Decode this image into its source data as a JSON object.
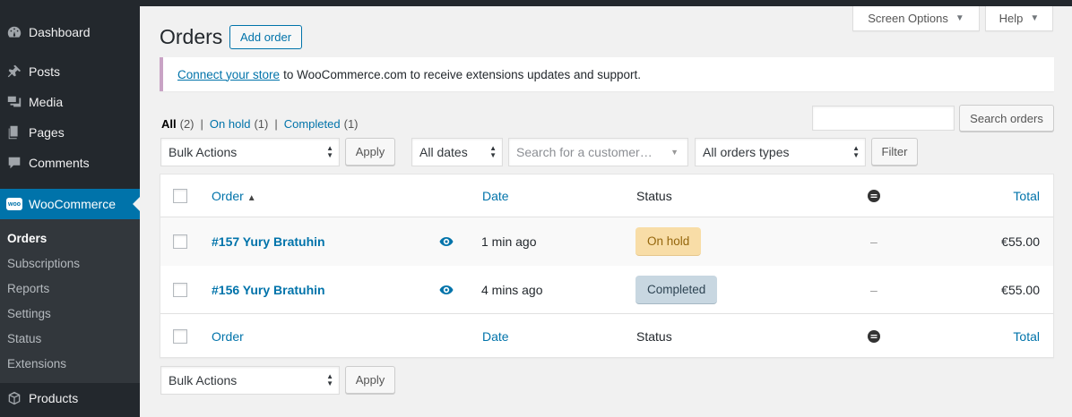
{
  "sidebar": {
    "items": [
      {
        "label": "Dashboard",
        "icon": "dashboard-icon"
      },
      {
        "label": "Posts",
        "icon": "pin-icon"
      },
      {
        "label": "Media",
        "icon": "media-icon"
      },
      {
        "label": "Pages",
        "icon": "pages-icon"
      },
      {
        "label": "Comments",
        "icon": "comment-icon"
      },
      {
        "label": "WooCommerce",
        "icon": "woo-icon",
        "badge": "woo"
      },
      {
        "label": "Products",
        "icon": "box-icon"
      }
    ],
    "submenu": [
      "Orders",
      "Subscriptions",
      "Reports",
      "Settings",
      "Status",
      "Extensions"
    ]
  },
  "header": {
    "title": "Orders",
    "add_order": "Add order",
    "screen_options": "Screen Options",
    "help": "Help"
  },
  "notice": {
    "link": "Connect your store",
    "text": "to WooCommerce.com to receive extensions updates and support."
  },
  "filters": {
    "all": "All",
    "all_count": "(2)",
    "on_hold": "On hold",
    "on_hold_count": "(1)",
    "completed": "Completed",
    "completed_count": "(1)"
  },
  "search": {
    "value": "",
    "button": "Search orders"
  },
  "toolbar": {
    "bulk_actions": "Bulk Actions",
    "apply": "Apply",
    "dates": "All dates",
    "customer_placeholder": "Search for a customer…",
    "order_types": "All orders types",
    "filter": "Filter"
  },
  "table": {
    "columns": {
      "order": "Order",
      "date": "Date",
      "status": "Status",
      "total": "Total"
    },
    "rows": [
      {
        "order": "#157 Yury Bratuhin",
        "date": "1 min ago",
        "status": "On hold",
        "billing": "–",
        "total": "€55.00"
      },
      {
        "order": "#156 Yury Bratuhin",
        "date": "4 mins ago",
        "status": "Completed",
        "billing": "–",
        "total": "€55.00"
      }
    ]
  },
  "colors": {
    "accent": "#0073aa",
    "sidebar_bg": "#23282d",
    "on_hold_bg": "#f8dda7",
    "completed_bg": "#c8d7e1"
  }
}
